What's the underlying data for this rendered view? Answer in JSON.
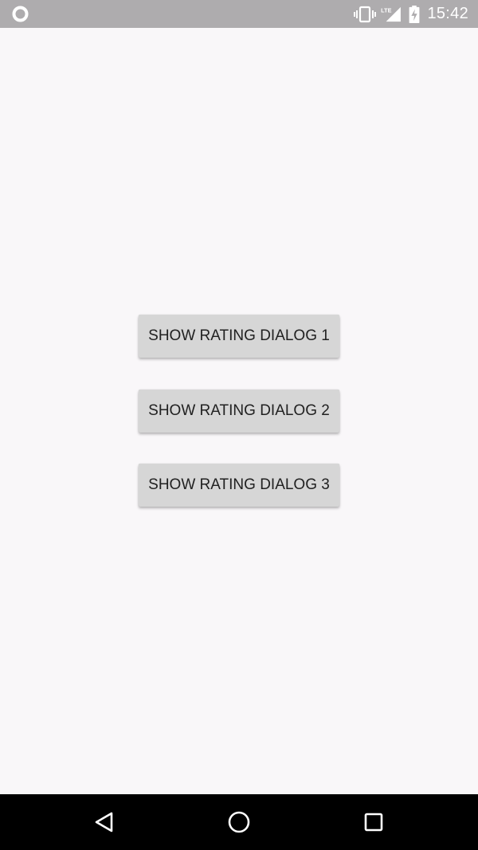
{
  "status_bar": {
    "time": "15:42",
    "network_label": "LTE",
    "icons": [
      "notification-circle-icon",
      "vibrate-icon",
      "lte-signal-icon",
      "battery-charging-icon"
    ]
  },
  "main": {
    "buttons": [
      {
        "label": "SHOW RATING DIALOG 1"
      },
      {
        "label": "SHOW RATING DIALOG 2"
      },
      {
        "label": "SHOW RATING DIALOG 3"
      }
    ]
  },
  "nav_bar": {
    "icons": [
      "back-icon",
      "home-icon",
      "recents-icon"
    ]
  },
  "colors": {
    "status_bar": "#aeacae",
    "background": "#f9f7f9",
    "button": "#d6d6d6",
    "nav_bar": "#000000"
  }
}
